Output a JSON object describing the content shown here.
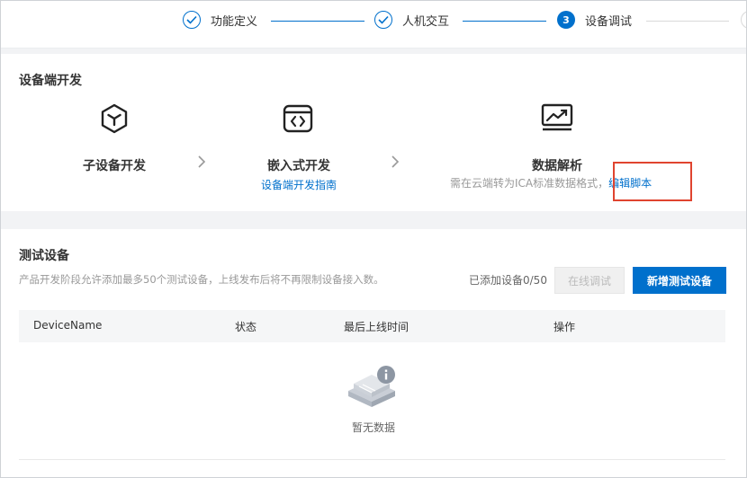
{
  "stepper": {
    "steps": [
      {
        "label": "功能定义",
        "status": "done"
      },
      {
        "label": "人机交互",
        "status": "done"
      },
      {
        "label": "设备调试",
        "status": "active",
        "number": "3"
      }
    ]
  },
  "device_dev": {
    "title": "设备端开发",
    "items": [
      {
        "title": "子设备开发",
        "icon": "cube-icon"
      },
      {
        "title": "嵌入式开发",
        "link": "设备端开发指南",
        "icon": "code-window-icon"
      },
      {
        "title": "数据解析",
        "desc": "需在云端转为ICA标准数据格式，",
        "link": "编辑脚本",
        "icon": "chart-icon"
      }
    ]
  },
  "test_devices": {
    "title": "测试设备",
    "hint": "产品开发阶段允许添加最多50个测试设备，上线发布后将不再限制设备接入数。",
    "count_text": "已添加设备0/50",
    "online_debug_label": "在线调试",
    "add_button_label": "新增测试设备",
    "columns": [
      "DeviceName",
      "状态",
      "最后上线时间",
      "操作"
    ],
    "empty_text": "暂无数据"
  },
  "colors": {
    "primary": "#0070cc",
    "highlight": "#e0442f"
  }
}
